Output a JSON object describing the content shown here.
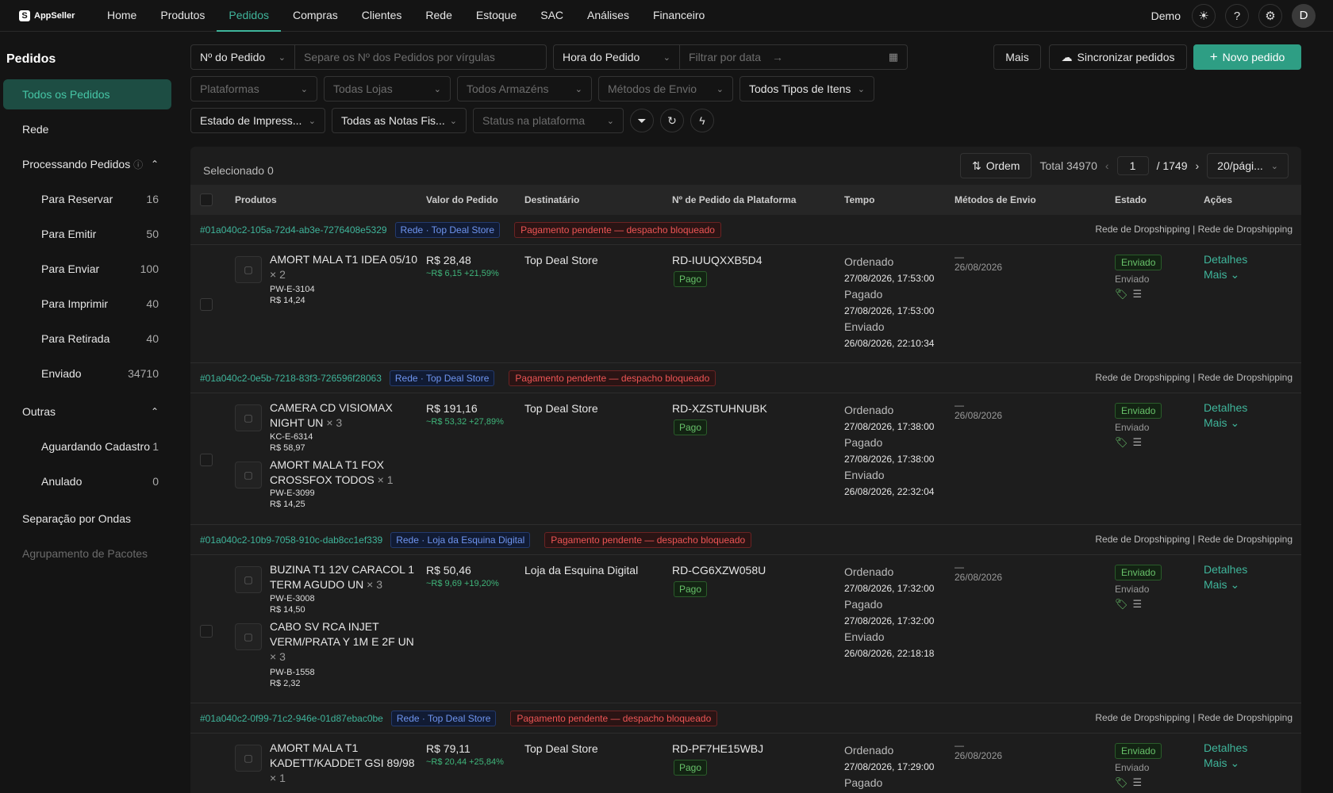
{
  "app": {
    "logo": "AppSeller"
  },
  "nav": {
    "items": [
      "Home",
      "Produtos",
      "Pedidos",
      "Compras",
      "Clientes",
      "Rede",
      "Estoque",
      "SAC",
      "Análises",
      "Financeiro"
    ],
    "active": "Pedidos",
    "user": "Demo",
    "avatar": "D"
  },
  "sidebar": {
    "title": "Pedidos",
    "all_orders": "Todos os Pedidos",
    "rede": "Rede",
    "processing": "Processando Pedidos",
    "processing_items": [
      {
        "label": "Para Reservar",
        "count": "16"
      },
      {
        "label": "Para Emitir",
        "count": "50"
      },
      {
        "label": "Para Enviar",
        "count": "100"
      },
      {
        "label": "Para Imprimir",
        "count": "40"
      },
      {
        "label": "Para Retirada",
        "count": "40"
      },
      {
        "label": "Enviado",
        "count": "34710"
      }
    ],
    "outras": "Outras",
    "outras_items": [
      {
        "label": "Aguardando Cadastro",
        "count": "1"
      },
      {
        "label": "Anulado",
        "count": "0"
      }
    ],
    "waves": "Separação por Ondas",
    "grouping": "Agrupamento de Pacotes"
  },
  "filters": {
    "order_no": "Nº do Pedido",
    "order_no_placeholder": "Separe os Nº dos Pedidos por vírgulas",
    "time": "Hora do Pedido",
    "date_placeholder": "Filtrar por data",
    "more": "Mais",
    "sync": "Sincronizar pedidos",
    "new_order": "Novo pedido",
    "platforms": "Plataformas",
    "stores": "Todas Lojas",
    "warehouses": "Todos Armazéns",
    "ship_methods": "Métodos de Envio",
    "item_types": "Todos Tipos de Itens",
    "print_state": "Estado de Impress...",
    "invoices": "Todas as Notas Fis...",
    "platform_status": "Status na plataforma"
  },
  "table": {
    "selected": "Selecionado 0",
    "order_btn": "Ordem",
    "total": "Total 34970",
    "page": "1",
    "pages": "/ 1749",
    "page_size": "20/pági...",
    "columns": [
      "Produtos",
      "Valor do Pedido",
      "Destinatário",
      "Nº de Pedido da Plataforma",
      "Tempo",
      "Métodos de Envio",
      "Estado",
      "Ações"
    ]
  },
  "orders": [
    {
      "id": "#01a040c2-105a-72d4-ab3e-7276408e5329",
      "store_tag": "Rede · Top Deal Store",
      "warn_tag": "Pagamento pendente — despacho bloqueado",
      "ship_net": "Rede de Dropshipping | Rede de Dropshipping",
      "products": [
        {
          "name": "AMORT MALA T1 IDEA 05/10",
          "qty": "× 2",
          "sku": "PW-E-3104",
          "price": "R$ 14,24"
        }
      ],
      "value": "R$ 28,48",
      "margin": "~R$ 6,15 +21,59%",
      "recipient": "Top Deal Store",
      "platform_no": "RD-IUUQXXB5D4",
      "paid_tag": "Pago",
      "time_labels": [
        "Ordenado",
        "Pagado",
        "Enviado"
      ],
      "times": [
        "27/08/2026, 17:53:00",
        "27/08/2026, 17:53:00",
        "26/08/2026, 22:10:34"
      ],
      "ship_dash": "—",
      "ship_date": "26/08/2026",
      "status_tag": "Enviado",
      "status_sub": "Enviado",
      "details": "Detalhes",
      "more": "Mais"
    },
    {
      "id": "#01a040c2-0e5b-7218-83f3-726596f28063",
      "store_tag": "Rede · Top Deal Store",
      "warn_tag": "Pagamento pendente — despacho bloqueado",
      "ship_net": "Rede de Dropshipping | Rede de Dropshipping",
      "products": [
        {
          "name": "CAMERA CD VISIOMAX NIGHT UN",
          "qty": "× 3",
          "sku": "KC-E-6314",
          "price": "R$ 58,97"
        },
        {
          "name": "AMORT MALA T1 FOX CROSSFOX TODOS",
          "qty": "× 1",
          "sku": "PW-E-3099",
          "price": "R$ 14,25"
        }
      ],
      "value": "R$ 191,16",
      "margin": "~R$ 53,32 +27,89%",
      "recipient": "Top Deal Store",
      "platform_no": "RD-XZSTUHNUBK",
      "paid_tag": "Pago",
      "time_labels": [
        "Ordenado",
        "Pagado",
        "Enviado"
      ],
      "times": [
        "27/08/2026, 17:38:00",
        "27/08/2026, 17:38:00",
        "26/08/2026, 22:32:04"
      ],
      "ship_dash": "—",
      "ship_date": "26/08/2026",
      "status_tag": "Enviado",
      "status_sub": "Enviado",
      "details": "Detalhes",
      "more": "Mais"
    },
    {
      "id": "#01a040c2-10b9-7058-910c-dab8cc1ef339",
      "store_tag": "Rede · Loja da Esquina Digital",
      "warn_tag": "Pagamento pendente — despacho bloqueado",
      "ship_net": "Rede de Dropshipping | Rede de Dropshipping",
      "products": [
        {
          "name": "BUZINA T1 12V CARACOL 1 TERM AGUDO UN",
          "qty": "× 3",
          "sku": "PW-E-3008",
          "price": "R$ 14,50"
        },
        {
          "name": "CABO SV RCA INJET VERM/PRATA Y 1M E 2F UN",
          "qty": "× 3",
          "sku": "PW-B-1558",
          "price": "R$ 2,32"
        }
      ],
      "value": "R$ 50,46",
      "margin": "~R$ 9,69 +19,20%",
      "recipient": "Loja da Esquina Digital",
      "platform_no": "RD-CG6XZW058U",
      "paid_tag": "Pago",
      "time_labels": [
        "Ordenado",
        "Pagado",
        "Enviado"
      ],
      "times": [
        "27/08/2026, 17:32:00",
        "27/08/2026, 17:32:00",
        "26/08/2026, 22:18:18"
      ],
      "ship_dash": "—",
      "ship_date": "26/08/2026",
      "status_tag": "Enviado",
      "status_sub": "Enviado",
      "details": "Detalhes",
      "more": "Mais"
    },
    {
      "id": "#01a040c2-0f99-71c2-946e-01d87ebac0be",
      "store_tag": "Rede · Top Deal Store",
      "warn_tag": "Pagamento pendente — despacho bloqueado",
      "ship_net": "Rede de Dropshipping | Rede de Dropshipping",
      "products": [
        {
          "name": "AMORT MALA T1 KADETT/KADDET GSI 89/98",
          "qty": "× 1",
          "sku": "",
          "price": ""
        }
      ],
      "value": "R$ 79,11",
      "margin": "~R$ 20,44 +25,84%",
      "recipient": "Top Deal Store",
      "platform_no": "RD-PF7HE15WBJ",
      "paid_tag": "Pago",
      "time_labels": [
        "Ordenado",
        "Pagado",
        ""
      ],
      "times": [
        "27/08/2026, 17:29:00",
        "",
        ""
      ],
      "ship_dash": "—",
      "ship_date": "26/08/2026",
      "status_tag": "Enviado",
      "status_sub": "Enviado",
      "details": "Detalhes",
      "more": "Mais"
    }
  ]
}
